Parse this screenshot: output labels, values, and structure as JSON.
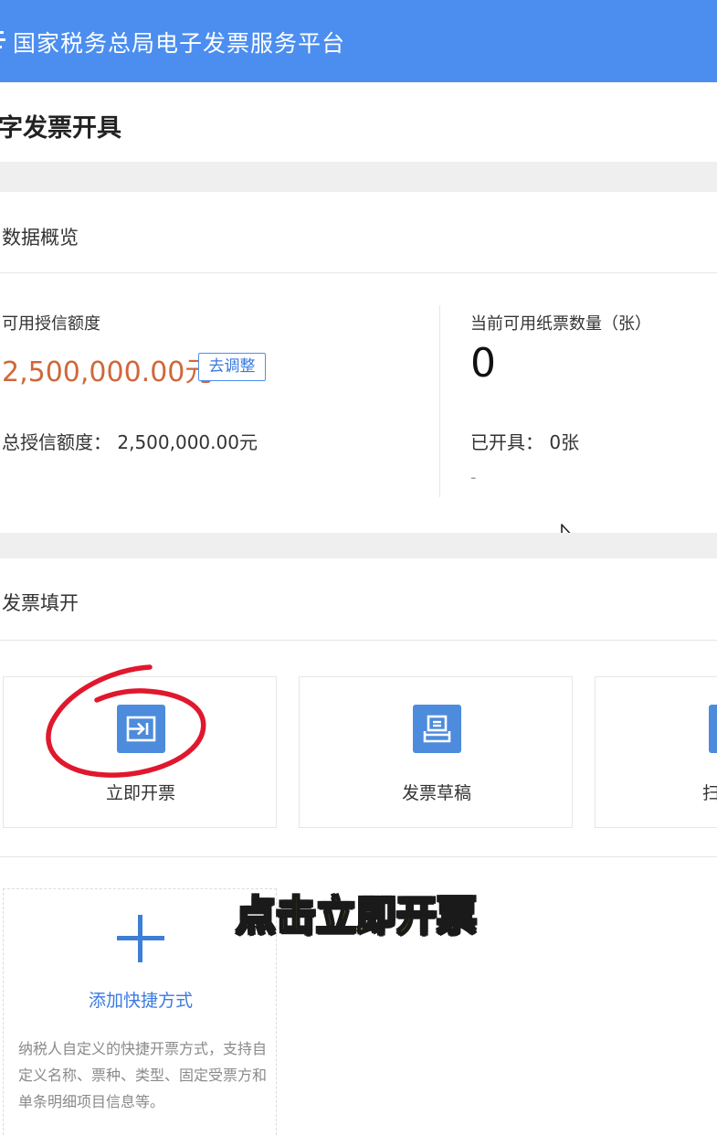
{
  "header": {
    "title": "国家税务总局电子发票服务平台"
  },
  "page": {
    "title": "字发票开具"
  },
  "overview": {
    "section_title": "数据概览",
    "credit_label": "可用授信额度",
    "credit_amount": "2,500,000.00元",
    "adjust_button": "去调整",
    "total_credit": "总授信额度： 2,500,000.00元",
    "paper_label": "当前可用纸票数量（张）",
    "paper_count": "0",
    "issued": "已开具： 0张",
    "dash": "-"
  },
  "invoice_fill": {
    "section_title": "发票填开",
    "cards": [
      {
        "label": "立即开票",
        "icon": "invoice-issue-icon"
      },
      {
        "label": "发票草稿",
        "icon": "draft-icon"
      },
      {
        "label": "扫码",
        "icon": "scan-icon"
      }
    ]
  },
  "shortcut": {
    "add_label": "添加快捷方式",
    "description": "纳税人自定义的快捷开票方式，支持自定义名称、票种、类型、固定受票方和单条明细项目信息等。"
  },
  "caption": "点击立即开票",
  "colors": {
    "accent": "#4b8ef0",
    "amount": "#d0673a",
    "annotation": "#e0182d",
    "caption": "#ffe324"
  }
}
